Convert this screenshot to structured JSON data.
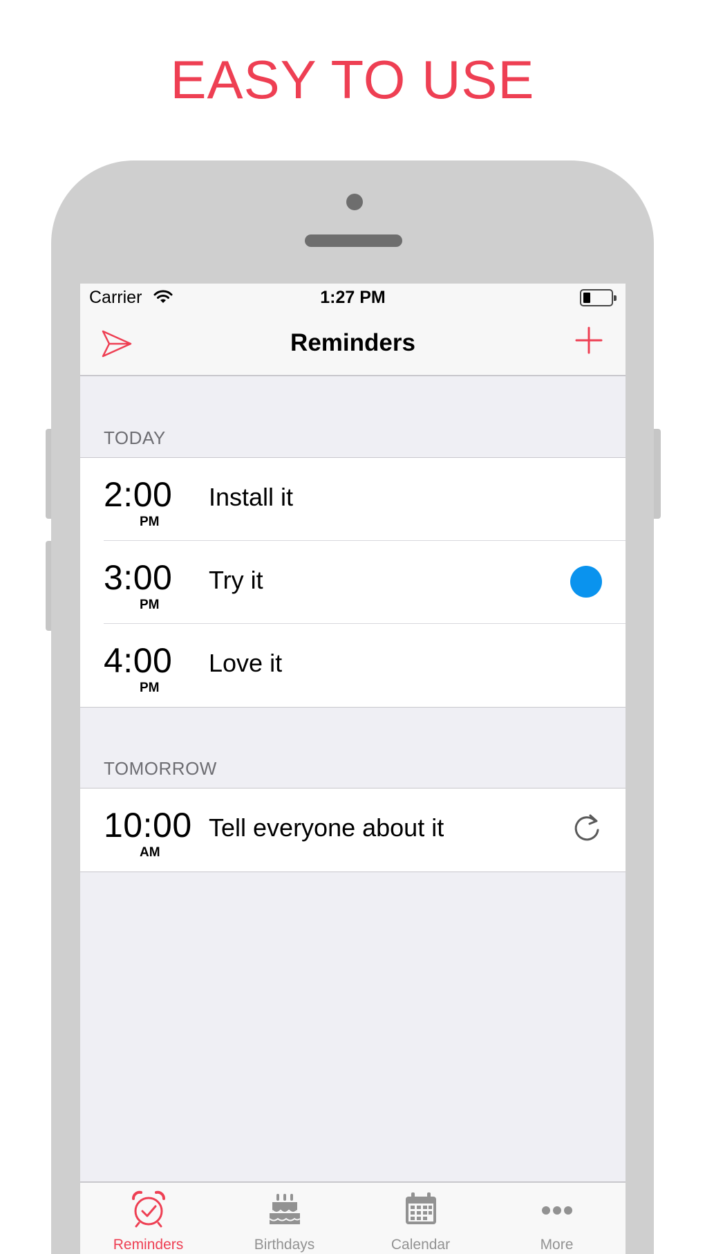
{
  "headline": "EASY TO USE",
  "colors": {
    "accent": "#ee3f53",
    "dot": "#0a93ee",
    "phone_frame": "#cfcfcf"
  },
  "status_bar": {
    "carrier": "Carrier",
    "time": "1:27 PM",
    "wifi_icon": "wifi-icon",
    "battery_icon": "battery-icon"
  },
  "nav": {
    "title": "Reminders",
    "left_icon": "send-icon",
    "right_icon": "plus-icon"
  },
  "sections": [
    {
      "header": "TODAY",
      "items": [
        {
          "time": "2:00",
          "ampm": "PM",
          "title": "Install it"
        },
        {
          "time": "3:00",
          "ampm": "PM",
          "title": "Try it",
          "badge": "blue-dot"
        },
        {
          "time": "4:00",
          "ampm": "PM",
          "title": "Love it"
        }
      ]
    },
    {
      "header": "TOMORROW",
      "items": [
        {
          "time": "10:00",
          "ampm": "AM",
          "title": "Tell everyone about it",
          "badge": "repeat-icon"
        }
      ]
    }
  ],
  "tabs": [
    {
      "label": "Reminders",
      "icon": "alarm-clock-icon",
      "active": true
    },
    {
      "label": "Birthdays",
      "icon": "cake-icon",
      "active": false
    },
    {
      "label": "Calendar",
      "icon": "calendar-icon",
      "active": false
    },
    {
      "label": "More",
      "icon": "more-icon",
      "active": false
    }
  ]
}
